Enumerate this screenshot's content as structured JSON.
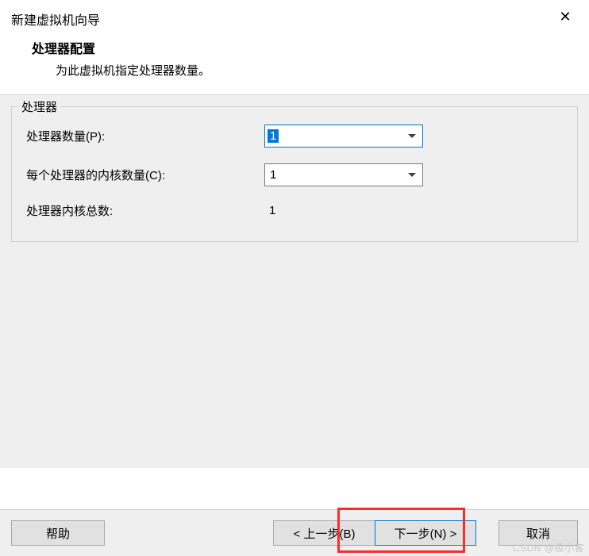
{
  "window": {
    "title": "新建虚拟机向导"
  },
  "header": {
    "title": "处理器配置",
    "subtitle": "为此虚拟机指定处理器数量。"
  },
  "group": {
    "label": "处理器",
    "rows": {
      "processors": {
        "label": "处理器数量(P):",
        "value": "1"
      },
      "cores": {
        "label": "每个处理器的内核数量(C):",
        "value": "1"
      },
      "total": {
        "label": "处理器内核总数:",
        "value": "1"
      }
    }
  },
  "footer": {
    "help": "帮助",
    "back": "< 上一步(B)",
    "next": "下一步(N) >",
    "cancel": "取消"
  },
  "watermark": "CSDN @极小客"
}
